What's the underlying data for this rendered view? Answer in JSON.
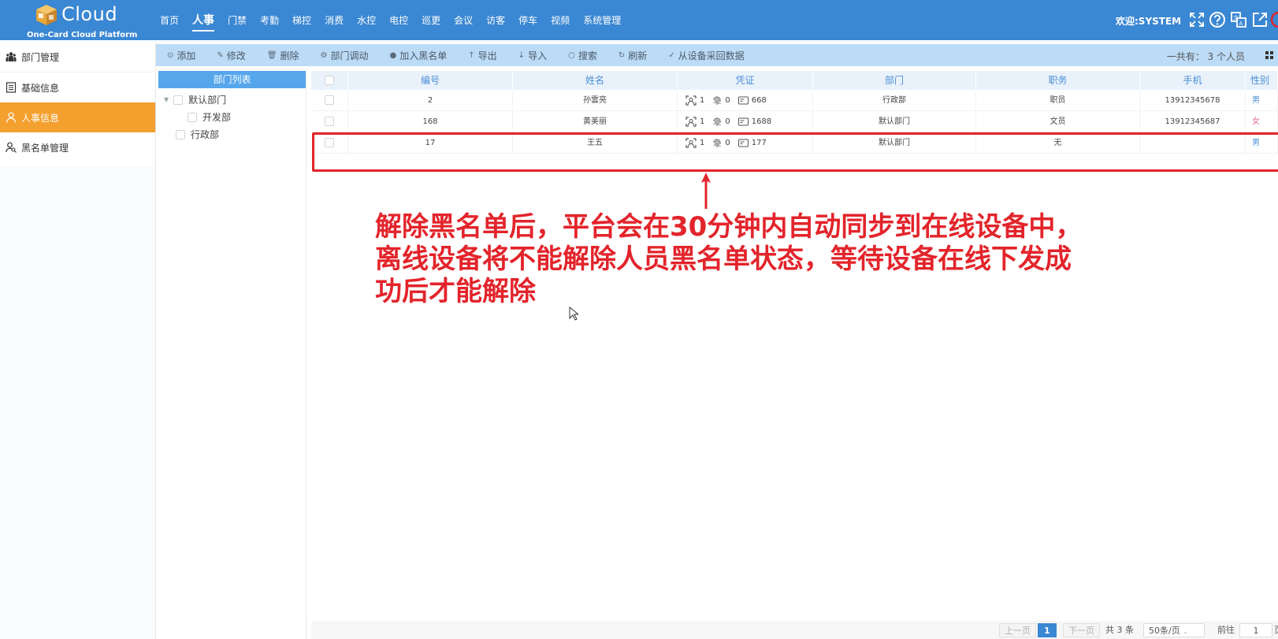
{
  "header": {
    "logo_text": "Cloud",
    "logo_subtitle": "One-Card Cloud Platform",
    "nav": [
      {
        "label": "首页"
      },
      {
        "label": "人事",
        "active": true
      },
      {
        "label": "门禁"
      },
      {
        "label": "考勤"
      },
      {
        "label": "梯控"
      },
      {
        "label": "消费"
      },
      {
        "label": "水控"
      },
      {
        "label": "电控"
      },
      {
        "label": "巡更"
      },
      {
        "label": "会议"
      },
      {
        "label": "访客"
      },
      {
        "label": "停车"
      },
      {
        "label": "视频"
      },
      {
        "label": "系统管理"
      }
    ],
    "welcome": "欢迎:SYSTEM",
    "icons": [
      "fullscreen-icon",
      "help-icon",
      "language-icon",
      "external-link-icon",
      "power-icon"
    ]
  },
  "sidebar": {
    "items": [
      {
        "label": "部门管理",
        "icon": "people-icon"
      },
      {
        "label": "基础信息",
        "icon": "list-icon"
      },
      {
        "label": "人事信息",
        "icon": "person-icon",
        "active": true
      },
      {
        "label": "黑名单管理",
        "icon": "person-search-icon"
      }
    ]
  },
  "toolbar": {
    "items": [
      {
        "label": "添加",
        "icon": "add-icon"
      },
      {
        "label": "修改",
        "icon": "edit-icon"
      },
      {
        "label": "删除",
        "icon": "delete-icon"
      },
      {
        "label": "部门调动",
        "icon": "transfer-icon"
      },
      {
        "label": "加入黑名单",
        "icon": "blacklist-icon"
      },
      {
        "label": "导出",
        "icon": "export-icon"
      },
      {
        "label": "导入",
        "icon": "import-icon"
      },
      {
        "label": "搜索",
        "icon": "search-icon"
      },
      {
        "label": "刷新",
        "icon": "refresh-icon"
      },
      {
        "label": "从设备采回数据",
        "icon": "check-icon"
      }
    ],
    "total_text": "一共有：  3 个人员"
  },
  "dept_tree": {
    "title": "部门列表",
    "nodes": [
      {
        "label": "默认部门",
        "level": 0
      },
      {
        "label": "开发部",
        "level": 1
      },
      {
        "label": "行政部",
        "level": 0
      }
    ]
  },
  "table": {
    "columns": [
      "编号",
      "姓名",
      "凭证",
      "部门",
      "职务",
      "手机",
      "性别"
    ],
    "rows": [
      {
        "id": "2",
        "name": "孙雲亮",
        "face": "1",
        "finger": "0",
        "card": "668",
        "dept": "行政部",
        "title": "职员",
        "phone": "13912345678",
        "gender": "男"
      },
      {
        "id": "168",
        "name": "黄美丽",
        "face": "1",
        "finger": "0",
        "card": "1688",
        "dept": "默认部门",
        "title": "文员",
        "phone": "13912345687",
        "gender": "女"
      },
      {
        "id": "17",
        "name": "王五",
        "face": "1",
        "finger": "0",
        "card": "177",
        "dept": "默认部门",
        "title": "无",
        "phone": "",
        "gender": "男"
      }
    ]
  },
  "annotation": {
    "line1": "解除黑名单后，平台会在30分钟内自动同步到在线设备中，",
    "line2": "离线设备将不能解除人员黑名单状态，等待设备在线下发成",
    "line3": "功后才能解除",
    "color": "#e3242b"
  },
  "pagination": {
    "prev": "上一页",
    "current": "1",
    "next": "下一页",
    "total": "共 3 条",
    "page_size": "50条/页",
    "goto_label": "前往",
    "goto_value": "1",
    "page_suffix": "页"
  },
  "colors": {
    "header_bg": "#3a87d3",
    "active_sidebar": "#f3a02e",
    "toolbar_bg": "#bcdbf6"
  }
}
